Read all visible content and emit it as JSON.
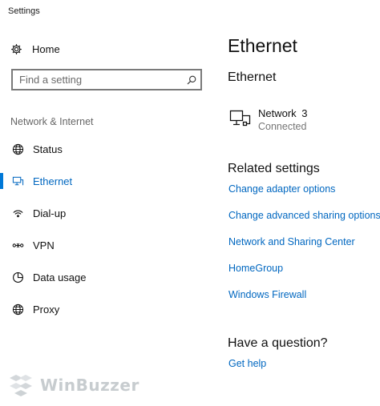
{
  "window": {
    "title": "Settings"
  },
  "sidebar": {
    "home_label": "Home",
    "search": {
      "placeholder": "Find a setting"
    },
    "section_label": "Network & Internet",
    "items": [
      {
        "label": "Status",
        "icon": "globe-icon",
        "active": false
      },
      {
        "label": "Ethernet",
        "icon": "ethernet-icon",
        "active": true
      },
      {
        "label": "Dial-up",
        "icon": "dialup-icon",
        "active": false
      },
      {
        "label": "VPN",
        "icon": "vpn-icon",
        "active": false
      },
      {
        "label": "Data usage",
        "icon": "data-usage-icon",
        "active": false
      },
      {
        "label": "Proxy",
        "icon": "globe-icon",
        "active": false
      }
    ]
  },
  "main": {
    "page_title": "Ethernet",
    "sub_title": "Ethernet",
    "network": {
      "name": "Network 3",
      "status": "Connected",
      "icon": "wired-network-icon"
    },
    "related_title": "Related settings",
    "related_links": [
      "Change adapter options",
      "Change advanced sharing options",
      "Network and Sharing Center",
      "HomeGroup",
      "Windows Firewall"
    ],
    "question_title": "Have a question?",
    "help_link": "Get help"
  },
  "watermark": {
    "text": "WinBuzzer"
  },
  "colors": {
    "accent": "#0078d7",
    "link": "#0067c0",
    "secondary_text": "#767676"
  }
}
